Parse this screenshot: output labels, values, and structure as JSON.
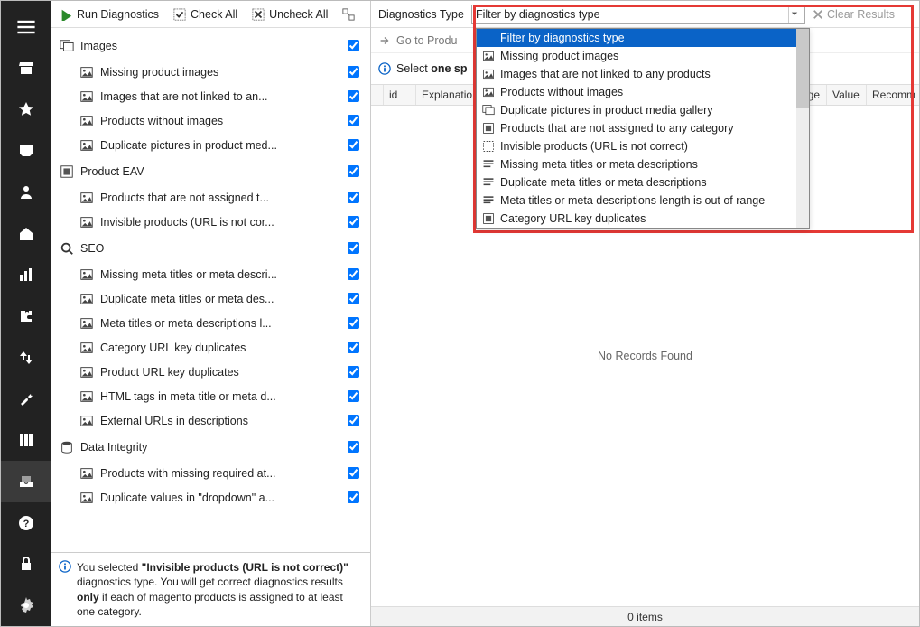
{
  "vnav": {
    "items": [
      {
        "name": "menu-icon"
      },
      {
        "name": "store-icon"
      },
      {
        "name": "star-icon"
      },
      {
        "name": "inbox-icon"
      },
      {
        "name": "person-icon"
      },
      {
        "name": "home-icon"
      },
      {
        "name": "chart-icon"
      },
      {
        "name": "puzzle-icon"
      },
      {
        "name": "updown-icon"
      },
      {
        "name": "wrench-icon"
      },
      {
        "name": "columns-icon"
      },
      {
        "name": "tray-icon",
        "selected": true
      },
      {
        "name": "help-icon"
      },
      {
        "name": "lock-icon"
      },
      {
        "name": "gear-icon"
      }
    ]
  },
  "toolbar": {
    "run_label": "Run Diagnostics",
    "check_all": "Check All",
    "uncheck_all": "Uncheck All"
  },
  "tree": {
    "groups": [
      {
        "label": "Images",
        "items": [
          {
            "label": "Missing product images"
          },
          {
            "label": "Images that are not linked to an..."
          },
          {
            "label": "Products without images"
          },
          {
            "label": "Duplicate pictures in product med..."
          }
        ]
      },
      {
        "label": "Product  EAV",
        "items": [
          {
            "label": "Products that are not assigned t..."
          },
          {
            "label": "Invisible products (URL is not cor..."
          }
        ]
      },
      {
        "label": "SEO",
        "items": [
          {
            "label": "Missing meta titles or meta descri..."
          },
          {
            "label": "Duplicate meta titles or meta des..."
          },
          {
            "label": "Meta titles or meta descriptions l..."
          },
          {
            "label": "Category URL key duplicates"
          },
          {
            "label": "Product URL key duplicates"
          },
          {
            "label": "HTML tags in meta title or meta d..."
          },
          {
            "label": "External URLs in descriptions"
          }
        ]
      },
      {
        "label": "Data Integrity",
        "items": [
          {
            "label": "Products with missing required at..."
          },
          {
            "label": "Duplicate values in \"dropdown\" a..."
          }
        ]
      }
    ]
  },
  "info": {
    "p1a": "You selected ",
    "p1b": "\"Invisible products (URL is not correct)\"",
    "p2a": " diagnostics type. You will get correct diagnostics results ",
    "p2b": "only",
    "p2c": " if each of magento products is assigned to at least one category."
  },
  "right": {
    "type_label": "Diagnostics Type",
    "filter_value": "Filter by diagnostics type",
    "clear_results": "Clear Results",
    "goto_product": "Go to Produ",
    "hint_a": "Select ",
    "hint_b": "one sp",
    "grid_cols": [
      "id",
      "Explanatio",
      "mage",
      "Value",
      "Recomm"
    ],
    "no_records": "No Records Found",
    "footer": "0 items"
  },
  "dropdown": {
    "items": [
      {
        "label": "Filter by diagnostics type",
        "icon": "none",
        "selected": true
      },
      {
        "label": "Missing product images",
        "icon": "img-warn"
      },
      {
        "label": "Images that are not linked to any products",
        "icon": "img-link"
      },
      {
        "label": "Products without images",
        "icon": "img"
      },
      {
        "label": "Duplicate pictures in product media gallery",
        "icon": "img-stack"
      },
      {
        "label": "Products that are not assigned to any category",
        "icon": "box-tree"
      },
      {
        "label": "Invisible products (URL is not correct)",
        "icon": "dashed-box"
      },
      {
        "label": "Missing meta titles or meta descriptions",
        "icon": "list"
      },
      {
        "label": "Duplicate meta titles or meta descriptions",
        "icon": "list-stack"
      },
      {
        "label": "Meta titles or meta descriptions length is out of range",
        "icon": "list-arrow"
      },
      {
        "label": "Category URL key duplicates",
        "icon": "tree-dup"
      }
    ]
  }
}
